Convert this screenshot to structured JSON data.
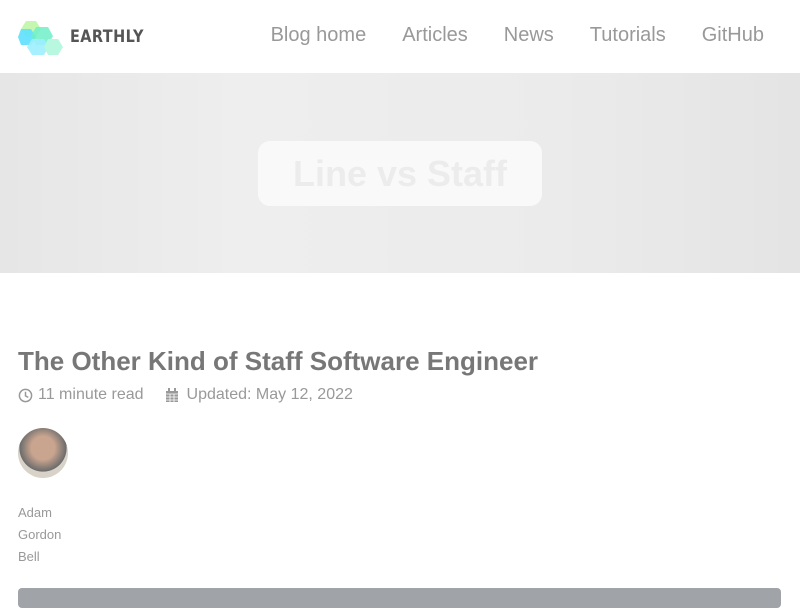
{
  "brand": "EARTHLY",
  "nav": [
    "Blog home",
    "Articles",
    "News",
    "Tutorials",
    "GitHub"
  ],
  "hero": {
    "title": "Line vs Staff"
  },
  "article": {
    "title": "The Other Kind of Staff Software Engineer",
    "read_time": "11 minute read",
    "updated": "Updated: May 12, 2022",
    "author": [
      "Adam",
      "Gordon",
      "Bell"
    ]
  }
}
